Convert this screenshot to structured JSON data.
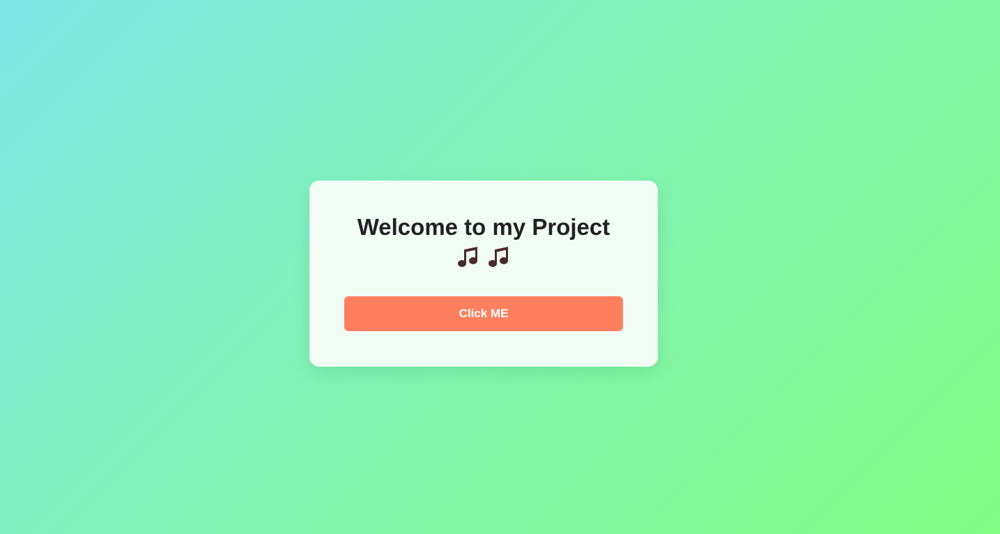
{
  "card": {
    "title": "Welcome to my Project",
    "icons": [
      "music-notes-icon",
      "music-notes-icon"
    ],
    "button_label": "Click ME"
  },
  "colors": {
    "background_start": "#7de8e6",
    "background_end": "#83fd85",
    "card_background": "#f1fcf5",
    "button": "#ff7f5f",
    "title_text": "#222222",
    "icon": "#4a2a2e"
  }
}
